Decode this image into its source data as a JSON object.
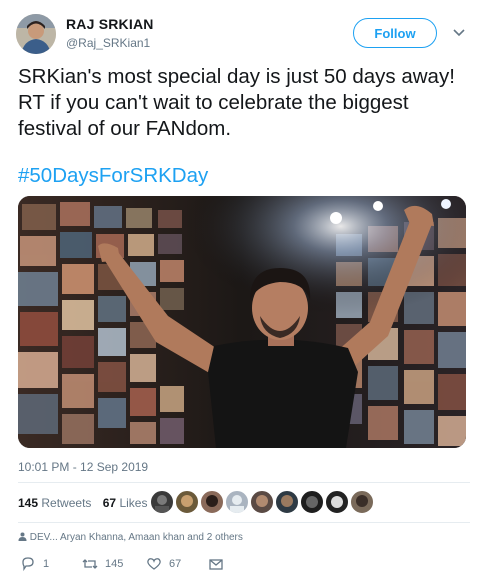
{
  "tweet": {
    "display_name": "RAJ SRKIAN",
    "handle": "@Raj_SRKian1",
    "follow_label": "Follow",
    "text": "SRKian's most special day is just 50 days away! RT if you can't wait to celebrate the biggest festival of our FANdom.",
    "hashtag": "#50DaysForSRKDay",
    "timestamp": "10:01 PM - 12 Sep 2019"
  },
  "stats": {
    "retweets_count": "145",
    "retweets_label": "Retweets",
    "likes_count": "67",
    "likes_label": "Likes"
  },
  "liker_avatars": [
    "avatar",
    "avatar",
    "avatar",
    "avatar",
    "avatar",
    "avatar",
    "avatar",
    "avatar",
    "avatar"
  ],
  "replying": {
    "text": "DEV... Aryan Khanna, Amaan khan and 2 others"
  },
  "actions": {
    "reply_count": "1",
    "retweet_count": "145",
    "like_count": "67"
  },
  "colors": {
    "accent": "#1da1f2",
    "text": "#14171a",
    "muted": "#657786"
  }
}
